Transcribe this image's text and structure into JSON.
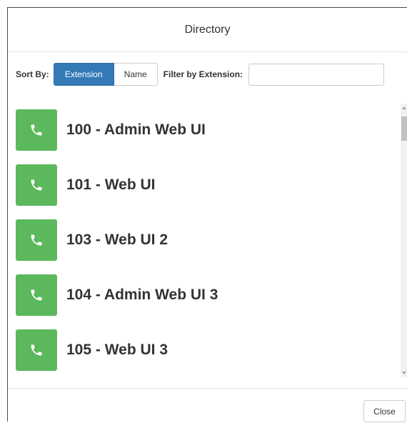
{
  "dialog": {
    "title": "Directory"
  },
  "toolbar": {
    "sort_label": "Sort By:",
    "sort_options": [
      "Extension",
      "Name"
    ],
    "sort_selected": "Extension",
    "filter_label": "Filter by Extension:",
    "filter_value": "",
    "filter_placeholder": ""
  },
  "directory": {
    "items": [
      {
        "label": "100 - Admin Web UI",
        "icon": "phone-icon"
      },
      {
        "label": "101 - Web UI",
        "icon": "phone-icon"
      },
      {
        "label": "103 - Web UI 2",
        "icon": "phone-icon"
      },
      {
        "label": "104 - Admin Web UI 3",
        "icon": "phone-icon"
      },
      {
        "label": "105 - Web UI 3",
        "icon": "phone-icon"
      }
    ]
  },
  "footer": {
    "close_label": "Close"
  },
  "colors": {
    "call_button": "#5cb85c",
    "active_sort": "#337ab7"
  }
}
